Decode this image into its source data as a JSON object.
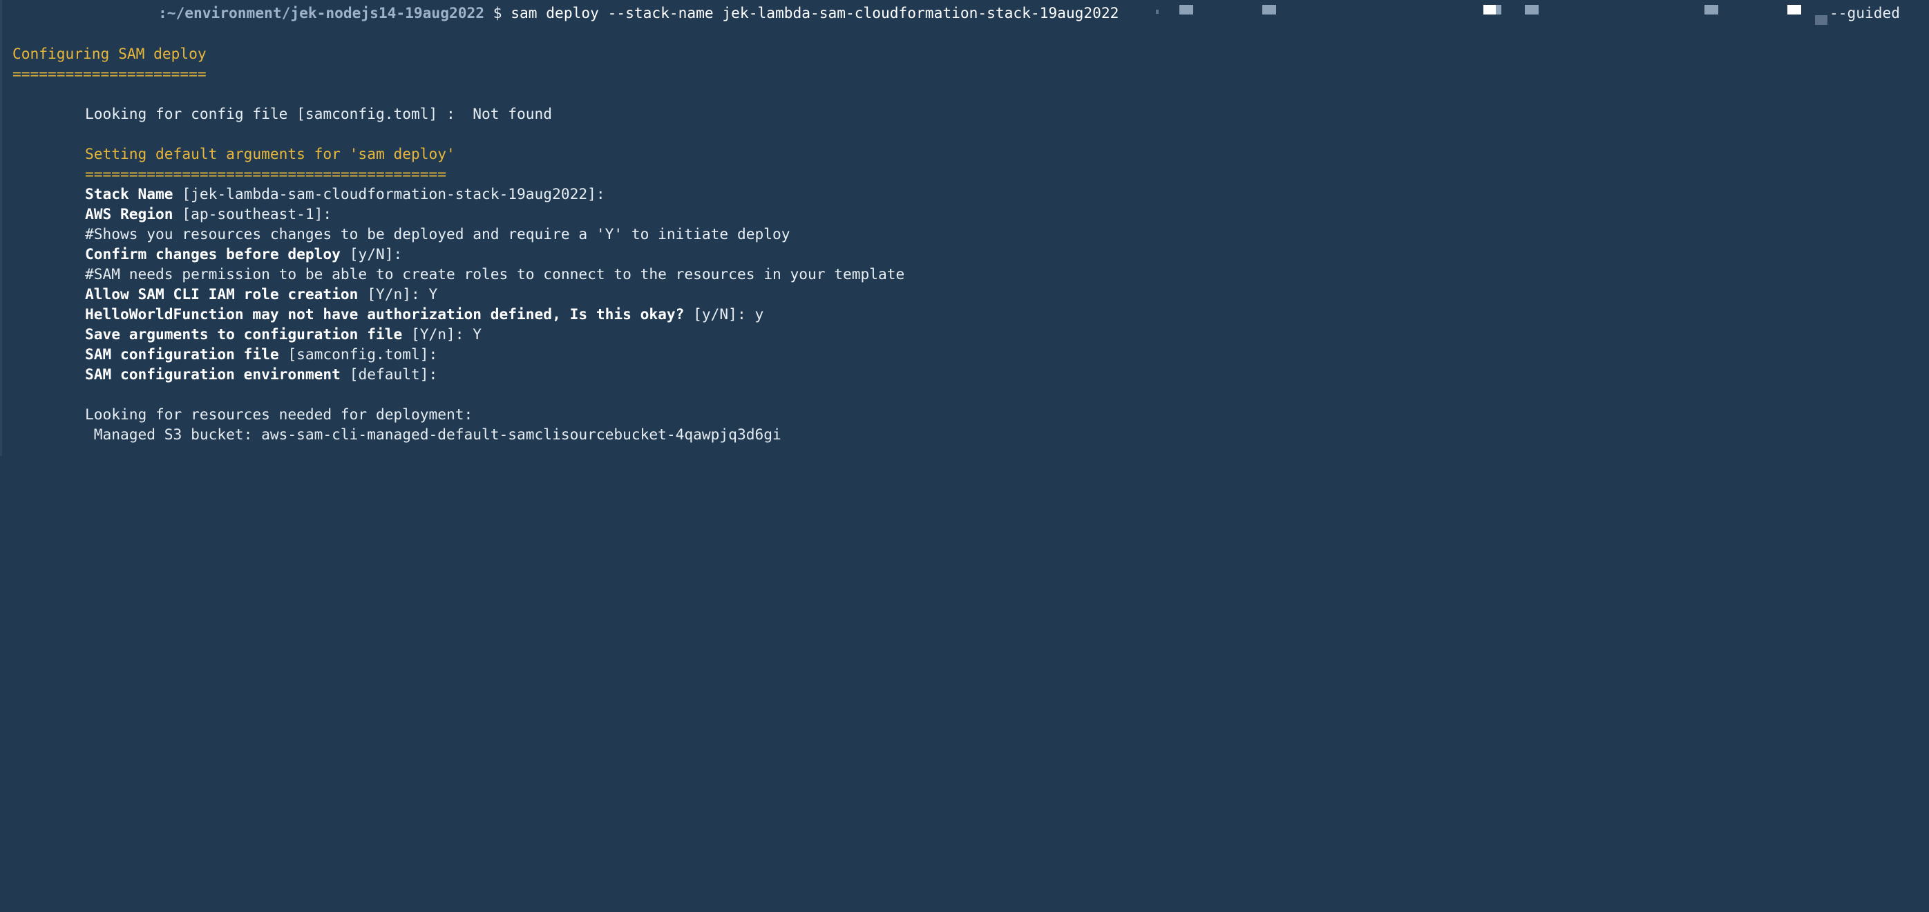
{
  "prompt": {
    "path": ":~/environment/jek-nodejs14-19aug2022",
    "symbol": "$",
    "command": "sam deploy --stack-name jek-lambda-sam-cloudformation-stack-19aug2022",
    "trailing_flag": "--guided"
  },
  "lines": {
    "configuring": "Configuring SAM deploy",
    "configuring_rule": "======================",
    "looking_config": "Looking for config file [samconfig.toml] :  Not found",
    "setting_defaults": "Setting default arguments for 'sam deploy'",
    "setting_rule": "=========================================",
    "stack_name_label": "Stack Name",
    "stack_name_value": " [jek-lambda-sam-cloudformation-stack-19aug2022]:",
    "region_label": "AWS Region",
    "region_value": " [ap-southeast-1]:",
    "comment_confirm": "#Shows you resources changes to be deployed and require a 'Y' to initiate deploy",
    "confirm_label": "Confirm changes before deploy",
    "confirm_value": " [y/N]:",
    "comment_permission": "#SAM needs permission to be able to create roles to connect to the resources in your template",
    "iam_label": "Allow SAM CLI IAM role creation",
    "iam_value": " [Y/n]: Y",
    "auth_label": "HelloWorldFunction may not have authorization defined, Is this okay?",
    "auth_value": " [y/N]: y",
    "save_label": "Save arguments to configuration file",
    "save_value": " [Y/n]: Y",
    "config_file_label": "SAM configuration file",
    "config_file_value": " [samconfig.toml]:",
    "config_env_label": "SAM configuration environment",
    "config_env_value": " [default]:",
    "looking_resources": "Looking for resources needed for deployment:",
    "managed_bucket": " Managed S3 bucket: aws-sam-cli-managed-default-samclisourcebucket-4qawpjq3d6gi"
  },
  "colors": {
    "background": "#213a52",
    "heading": "#e8b63a",
    "text": "#e6edf3"
  }
}
